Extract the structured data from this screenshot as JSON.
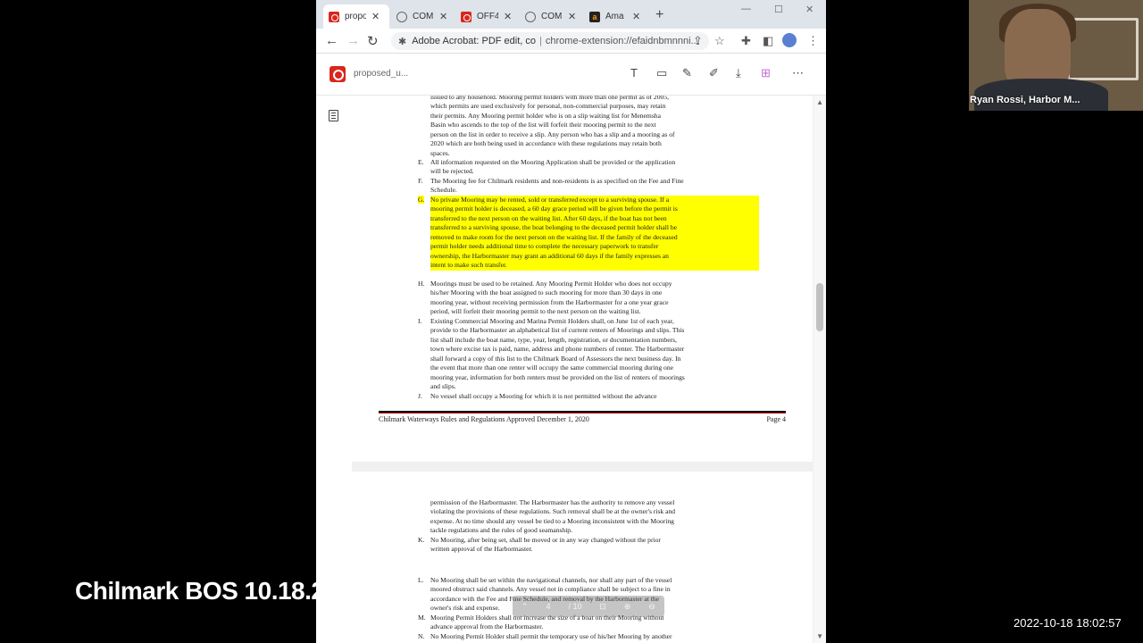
{
  "browser": {
    "tabs": [
      {
        "label": "propo",
        "icon": "acrobat-pdf-icon"
      },
      {
        "label": "COM",
        "icon": "globe-icon"
      },
      {
        "label": "OFF4",
        "icon": "acrobat-pdf-icon"
      },
      {
        "label": "COM",
        "icon": "globe-icon"
      },
      {
        "label": "Ama",
        "icon": "amazon-icon"
      }
    ],
    "omnibox": {
      "site": "Adobe Acrobat: PDF edit, co",
      "url": "chrome-extension://efaidnbmnnni..."
    }
  },
  "acrobat": {
    "doc_name": "proposed_u..."
  },
  "page4": {
    "items": [
      {
        "label": "",
        "highlight": false,
        "lines": [
          "issued to any household. Mooring permit holders with more than one permit as of 2005,",
          "which permits are used exclusively for personal, non-commercial purposes, may retain",
          "their permits. Any Mooring permit holder who is on a slip waiting list for Menemsha",
          "Basin who ascends to the top of the list will forfeit their mooring permit to the next",
          "person on the list in order to receive a slip. Any person who has a slip and a mooring as of",
          "2020 which are both being used in accordance with these regulations may retain both",
          "spaces."
        ]
      },
      {
        "label": "E.",
        "highlight": false,
        "lines": [
          "All information requested on the Mooring Application shall be provided or the application",
          "will be rejected."
        ]
      },
      {
        "label": "F.",
        "highlight": false,
        "lines": [
          "The Mooring fee for Chilmark residents and non-residents is as specified on the Fee and Fine",
          "Schedule."
        ]
      },
      {
        "label": "G.",
        "highlight": true,
        "lines": [
          "No private Mooring may be rented, sold or transferred except to a surviving spouse. If a",
          "mooring permit holder is deceased, a 60 day grace period will be given before the permit is",
          "transferred to the next person on the waiting list. After 60 days, if the boat has not been",
          "transferred to a surviving spouse, the boat belonging to the deceased permit holder shall be",
          "removed to make room for the next person on the waiting list. If the family of the deceased",
          "permit holder needs additional time to complete the necessary paperwork to transfer",
          "ownership, the Harbormaster may grant an additional 60 days if the family expresses an",
          "intent to make such transfer."
        ]
      },
      {
        "label": "H.",
        "highlight": false,
        "lines": [
          "Moorings must be used to be retained. Any Mooring Permit Holder who does not occupy",
          "his/her Mooring with the boat assigned to such mooring for more than 30 days in one",
          "mooring year, without receiving permission from the Harbormaster for a one year grace",
          "period, will forfeit their mooring permit to the next person on the waiting list."
        ]
      },
      {
        "label": "I.",
        "highlight": false,
        "lines": [
          "Existing Commercial Mooring and Marina Permit Holders shall, on June 1st of each year,",
          "provide to the Harbormaster an alphabetical list of current renters of Moorings and slips. This",
          "list shall include the boat name, type, year, length, registration, or documentation numbers,",
          "town where excise tax is paid, name, address and phone numbers of renter. The Harbormaster",
          "shall forward a copy of this list to the Chilmark Board of Assessors the next business day. In",
          "the event that more than one renter will occupy the same commercial mooring during one",
          "mooring year, information for both renters must be provided on the list of renters of moorings",
          "and slips."
        ]
      },
      {
        "label": "J.",
        "highlight": false,
        "lines": [
          "No vessel shall occupy a Mooring for which it is not permitted without the advance"
        ]
      }
    ],
    "footer_left": "Chilmark Waterways Rules and Regulations Approved December 1, 2020",
    "footer_right": "Page 4"
  },
  "page5": {
    "items": [
      {
        "label": "",
        "lines": [
          "permission of the Harbormaster. The Harbormaster has the authority to remove any vessel",
          "violating the provisions of these regulations. Such removal shall be at the owner's risk and",
          "expense. At no time should any vessel be tied to a Mooring inconsistent with the Mooring",
          "tackle regulations and the rules of good seamanship."
        ]
      },
      {
        "label": "K.",
        "lines": [
          "No Mooring, after being set, shall be moved or in any way changed without the prior",
          "written approval of the Harbormaster."
        ]
      },
      {
        "label": "L.",
        "lines": [
          "No Mooring shall be set within the navigational channels, nor shall any part of the vessel",
          "moored obstruct said channels. Any vessel not in compliance shall be subject to a fine in",
          "accordance with the Fee and Fine Schedule, and removal by the Harbormaster at the",
          "owner's risk and expense."
        ]
      },
      {
        "label": "M.",
        "lines": [
          "Mooring Permit Holders shall not increase the size of a boat on their Mooring without",
          "advance approval from the Harbormaster."
        ]
      },
      {
        "label": "N.",
        "lines": [
          "No Mooring Permit Holder shall permit the temporary use of his/her Mooring by another"
        ]
      }
    ]
  },
  "page_control": {
    "current": "4",
    "total": "/ 10"
  },
  "video": {
    "participant": "Ryan Rossi, Harbor M...",
    "meeting_title": "Chilmark BOS 10.18.2",
    "timestamp": "2022-10-18  18:02:57"
  }
}
